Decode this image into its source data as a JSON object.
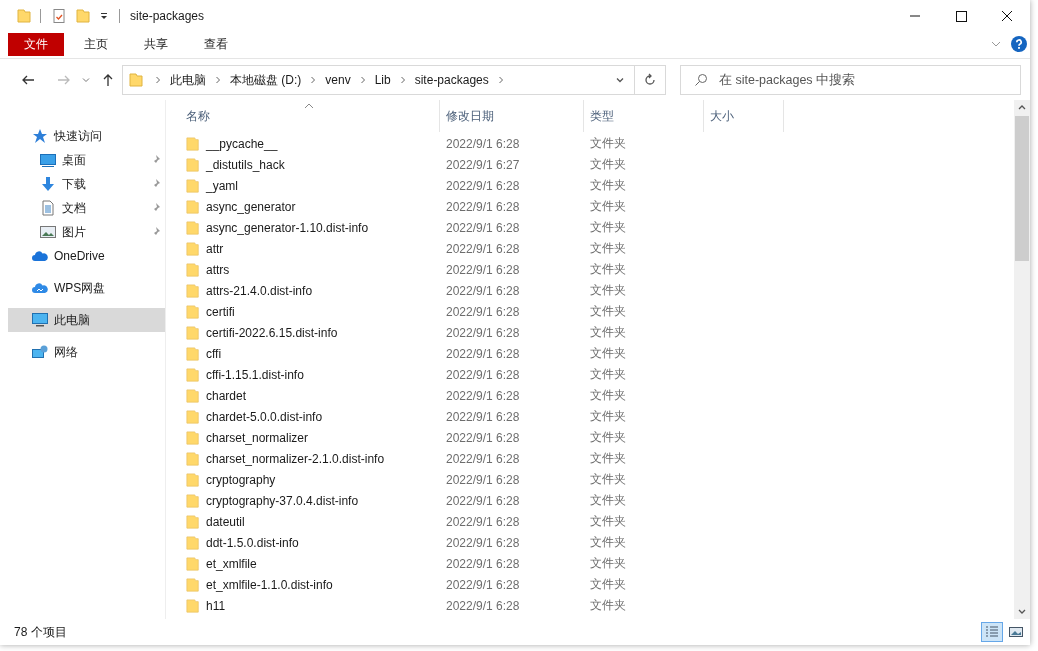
{
  "window": {
    "title": "site-packages"
  },
  "ribbon_tabs": [
    {
      "label": "文件",
      "kind": "file"
    },
    {
      "label": "主页",
      "kind": "tab"
    },
    {
      "label": "共享",
      "kind": "tab"
    },
    {
      "label": "查看",
      "kind": "tab"
    }
  ],
  "address": {
    "crumbs": [
      "此电脑",
      "本地磁盘 (D:)",
      "venv",
      "Lib",
      "site-packages"
    ]
  },
  "search": {
    "placeholder": "在 site-packages 中搜索"
  },
  "sidebar": {
    "items": [
      {
        "label": "快速访问",
        "kind": "star",
        "pinned": false,
        "selected": false
      },
      {
        "label": "桌面",
        "kind": "desktop",
        "pinned": true,
        "selected": false
      },
      {
        "label": "下载",
        "kind": "download",
        "pinned": true,
        "selected": false
      },
      {
        "label": "文档",
        "kind": "document",
        "pinned": true,
        "selected": false
      },
      {
        "label": "图片",
        "kind": "pictures",
        "pinned": true,
        "selected": false
      },
      {
        "label": "OneDrive",
        "kind": "cloud",
        "pinned": false,
        "selected": false
      },
      {
        "label": "WPS网盘",
        "kind": "cloud2",
        "pinned": false,
        "selected": false
      },
      {
        "label": "此电脑",
        "kind": "computer",
        "pinned": false,
        "selected": true
      },
      {
        "label": "网络",
        "kind": "network",
        "pinned": false,
        "selected": false
      }
    ]
  },
  "table": {
    "columns": [
      "名称",
      "修改日期",
      "类型",
      "大小"
    ],
    "rows": [
      {
        "name": "__pycache__",
        "date": "2022/9/1 6:28",
        "type": "文件夹"
      },
      {
        "name": "_distutils_hack",
        "date": "2022/9/1 6:27",
        "type": "文件夹"
      },
      {
        "name": "_yaml",
        "date": "2022/9/1 6:28",
        "type": "文件夹"
      },
      {
        "name": "async_generator",
        "date": "2022/9/1 6:28",
        "type": "文件夹"
      },
      {
        "name": "async_generator-1.10.dist-info",
        "date": "2022/9/1 6:28",
        "type": "文件夹"
      },
      {
        "name": "attr",
        "date": "2022/9/1 6:28",
        "type": "文件夹"
      },
      {
        "name": "attrs",
        "date": "2022/9/1 6:28",
        "type": "文件夹"
      },
      {
        "name": "attrs-21.4.0.dist-info",
        "date": "2022/9/1 6:28",
        "type": "文件夹"
      },
      {
        "name": "certifi",
        "date": "2022/9/1 6:28",
        "type": "文件夹"
      },
      {
        "name": "certifi-2022.6.15.dist-info",
        "date": "2022/9/1 6:28",
        "type": "文件夹"
      },
      {
        "name": "cffi",
        "date": "2022/9/1 6:28",
        "type": "文件夹"
      },
      {
        "name": "cffi-1.15.1.dist-info",
        "date": "2022/9/1 6:28",
        "type": "文件夹"
      },
      {
        "name": "chardet",
        "date": "2022/9/1 6:28",
        "type": "文件夹"
      },
      {
        "name": "chardet-5.0.0.dist-info",
        "date": "2022/9/1 6:28",
        "type": "文件夹"
      },
      {
        "name": "charset_normalizer",
        "date": "2022/9/1 6:28",
        "type": "文件夹"
      },
      {
        "name": "charset_normalizer-2.1.0.dist-info",
        "date": "2022/9/1 6:28",
        "type": "文件夹"
      },
      {
        "name": "cryptography",
        "date": "2022/9/1 6:28",
        "type": "文件夹"
      },
      {
        "name": "cryptography-37.0.4.dist-info",
        "date": "2022/9/1 6:28",
        "type": "文件夹"
      },
      {
        "name": "dateutil",
        "date": "2022/9/1 6:28",
        "type": "文件夹"
      },
      {
        "name": "ddt-1.5.0.dist-info",
        "date": "2022/9/1 6:28",
        "type": "文件夹"
      },
      {
        "name": "et_xmlfile",
        "date": "2022/9/1 6:28",
        "type": "文件夹"
      },
      {
        "name": "et_xmlfile-1.1.0.dist-info",
        "date": "2022/9/1 6:28",
        "type": "文件夹"
      },
      {
        "name": "h11",
        "date": "2022/9/1 6:28",
        "type": "文件夹"
      }
    ]
  },
  "status_bar": {
    "count": "78 个项目",
    "views": [
      {
        "kind": "details",
        "selected": true
      },
      {
        "kind": "thumbs",
        "selected": false
      }
    ]
  }
}
